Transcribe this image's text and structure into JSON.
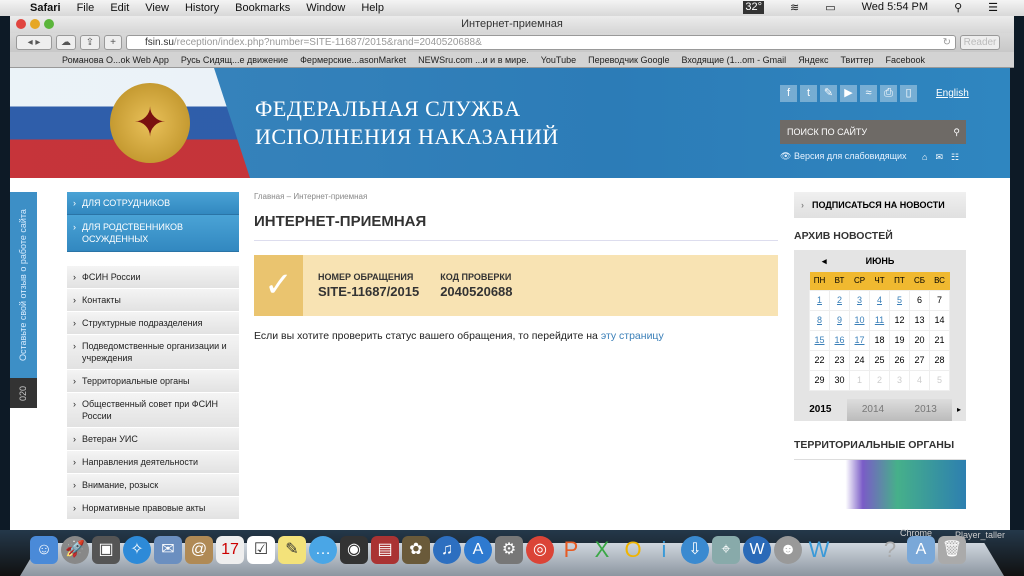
{
  "menubar": {
    "items": [
      "Safari",
      "File",
      "Edit",
      "View",
      "History",
      "Bookmarks",
      "Window",
      "Help"
    ],
    "temp": "32°",
    "clock": "Wed 5:54 PM"
  },
  "browser": {
    "title": "Интернет-приемная",
    "url_domain": "fsin.su",
    "url_path": "/reception/index.php?number=SITE-11687/2015&rand=2040520688&",
    "reader": "Reader",
    "bookmarks": [
      "Романова О...ok Web App",
      "Русь Сидящ...е движение",
      "Фермерские...asonMarket",
      "NEWSru.com ...и и в мире.",
      "YouTube",
      "Переводчик Google",
      "Входящие (1...om - Gmail",
      "Яндекс",
      "Твиттер",
      "Facebook"
    ]
  },
  "header": {
    "title_line1": "ФЕДЕРАЛЬНАЯ СЛУЖБА",
    "title_line2": "ИСПОЛНЕНИЯ НАКАЗАНИЙ",
    "english": "English",
    "search_placeholder": "ПОИСК ПО САЙТУ",
    "low_vision": "Версия для слабовидящих"
  },
  "feedback": {
    "label": "Оставьте свой отзыв о работе сайта",
    "count": "020"
  },
  "nav": {
    "blue": [
      "ДЛЯ СОТРУДНИКОВ",
      "ДЛЯ РОДСТВЕННИКОВ ОСУЖДЕННЫХ"
    ],
    "gray": [
      "ФСИН России",
      "Контакты",
      "Структурные подразделения",
      "Подведомственные организации и учреждения",
      "Территориальные органы",
      "Общественный совет при ФСИН России",
      "Ветеран УИС",
      "Направления деятельности",
      "Внимание, розыск",
      "Нормативные правовые акты"
    ]
  },
  "content": {
    "breadcrumb": "Главная – Интернет-приемная",
    "title": "ИНТЕРНЕТ-ПРИЕМНАЯ",
    "number_label": "НОМЕР ОБРАЩЕНИЯ",
    "number_value": "SITE-11687/2015",
    "code_label": "КОД ПРОВЕРКИ",
    "code_value": "2040520688",
    "info_text": "Если вы хотите проверить статус вашего обращения, то перейдите на ",
    "info_link": "эту страницу"
  },
  "right": {
    "subscribe": "ПОДПИСАТЬСЯ НА НОВОСТИ",
    "archive_title": "АРХИВ НОВОСТЕЙ",
    "month": "ИЮНЬ",
    "weekdays": [
      "ПН",
      "ВТ",
      "СР",
      "ЧТ",
      "ПТ",
      "СБ",
      "ВС"
    ],
    "weeks": [
      [
        "1",
        "2",
        "3",
        "4",
        "5",
        "6",
        "7"
      ],
      [
        "8",
        "9",
        "10",
        "11",
        "12",
        "13",
        "14"
      ],
      [
        "15",
        "16",
        "17",
        "18",
        "19",
        "20",
        "21"
      ],
      [
        "22",
        "23",
        "24",
        "25",
        "26",
        "27",
        "28"
      ],
      [
        "29",
        "30",
        "1",
        "2",
        "3",
        "4",
        "5"
      ]
    ],
    "years": [
      "2015",
      "2014",
      "2013"
    ],
    "territorial_title": "ТЕРРИТОРИАЛЬНЫЕ ОРГАНЫ"
  },
  "dock": {
    "labels": [
      "Chrome",
      "Player_taller"
    ]
  }
}
